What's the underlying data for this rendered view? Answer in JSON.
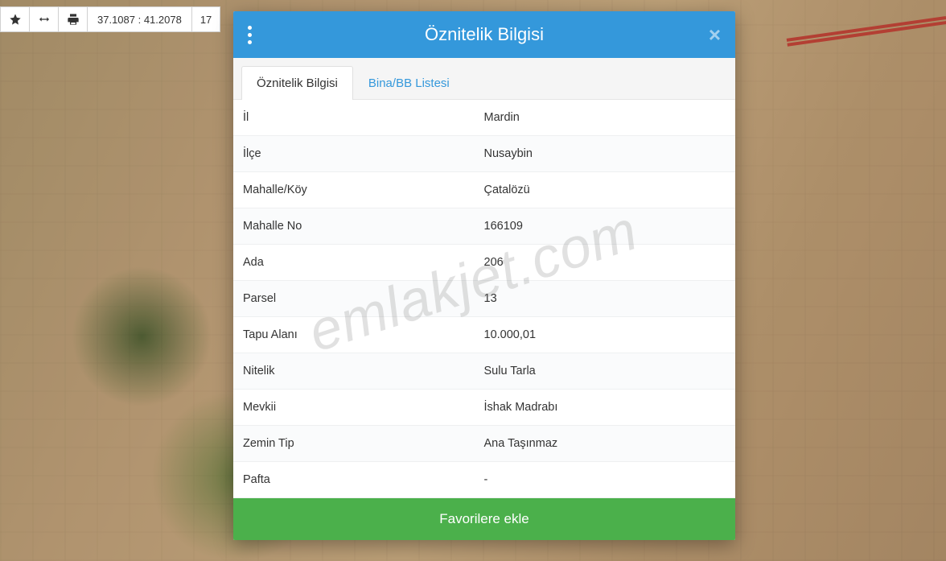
{
  "toolbar": {
    "coord": "37.1087 : 41.2078",
    "coord2": "17"
  },
  "modal": {
    "title": "Öznitelik Bilgisi",
    "tabs": {
      "attributes": "Öznitelik Bilgisi",
      "buildings": "Bina/BB Listesi"
    },
    "rows": [
      {
        "label": "İl",
        "value": "Mardin"
      },
      {
        "label": "İlçe",
        "value": "Nusaybin"
      },
      {
        "label": "Mahalle/Köy",
        "value": "Çatalözü"
      },
      {
        "label": "Mahalle No",
        "value": "166109"
      },
      {
        "label": "Ada",
        "value": "206"
      },
      {
        "label": "Parsel",
        "value": "13"
      },
      {
        "label": "Tapu Alanı",
        "value": "10.000,01"
      },
      {
        "label": "Nitelik",
        "value": "Sulu Tarla"
      },
      {
        "label": "Mevkii",
        "value": "İshak Madrabı"
      },
      {
        "label": "Zemin Tip",
        "value": "Ana Taşınmaz"
      },
      {
        "label": "Pafta",
        "value": "-"
      }
    ],
    "fav_button": "Favorilere ekle"
  },
  "watermark": "emlakjet.com"
}
